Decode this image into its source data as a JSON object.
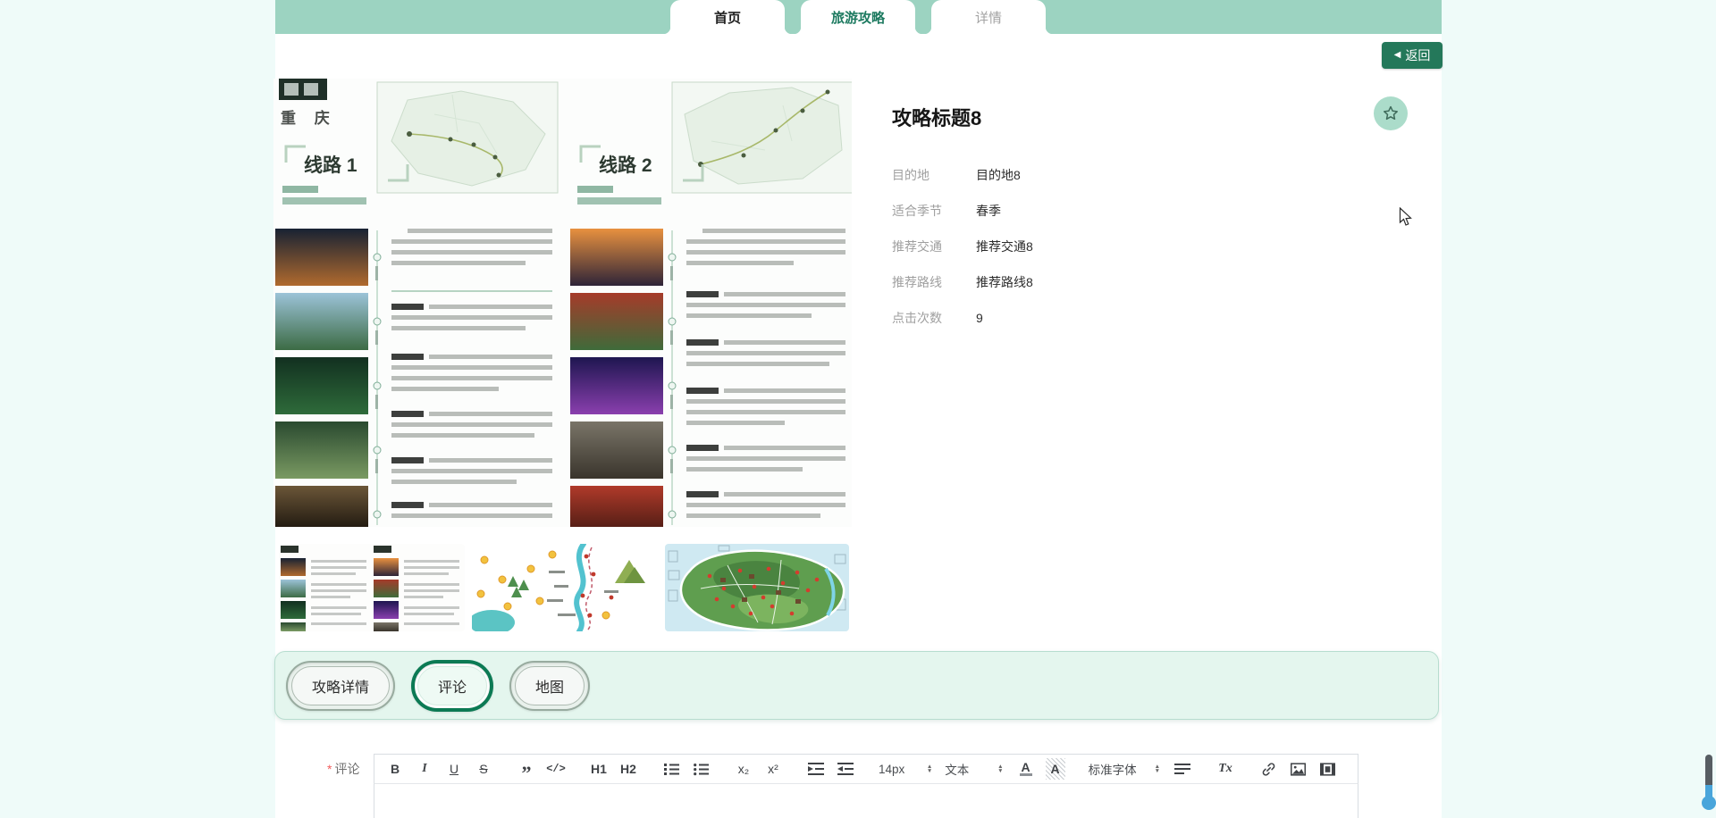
{
  "nav_tabs": {
    "items": [
      {
        "label": "首页"
      },
      {
        "label": "旅游攻略"
      },
      {
        "label": "详情"
      }
    ]
  },
  "back_button": {
    "label": "返回",
    "icon": "◀"
  },
  "guide": {
    "title": "攻略标题8",
    "fields": [
      {
        "label": "目的地",
        "value": "目的地8"
      },
      {
        "label": "适合季节",
        "value": "春季"
      },
      {
        "label": "推荐交通",
        "value": "推荐交通8"
      },
      {
        "label": "推荐路线",
        "value": "推荐路线8"
      },
      {
        "label": "点击次数",
        "value": "9"
      }
    ]
  },
  "brochure": {
    "region_label": "重 庆",
    "route1_label": "线路 1",
    "route2_label": "线路 2"
  },
  "section_tabs": {
    "items": [
      {
        "label": "攻略详情",
        "selected": false
      },
      {
        "label": "评论",
        "selected": true
      },
      {
        "label": "地图",
        "selected": false
      }
    ]
  },
  "comment_editor": {
    "required_mark": "*",
    "label": "评论",
    "toolbar": {
      "bold": "B",
      "italic": "I",
      "underline": "U",
      "strike": "S",
      "quote": "”",
      "code": "</>",
      "h1": "H1",
      "h2": "H2",
      "subscript": "x₂",
      "superscript": "x²",
      "font_size": "14px",
      "text_style": "文本",
      "color_label": "A",
      "highlight_label": "A",
      "font_family": "标准字体",
      "clear_format": "Tx"
    }
  },
  "colors": {
    "topbar": "#9cd3c1",
    "accent_dark_green": "#24785a",
    "selected_ring": "#0c7a54",
    "panel_mint": "#e4f6ee",
    "fav_circle": "#abdcca",
    "scroll_blue": "#49a5db"
  }
}
